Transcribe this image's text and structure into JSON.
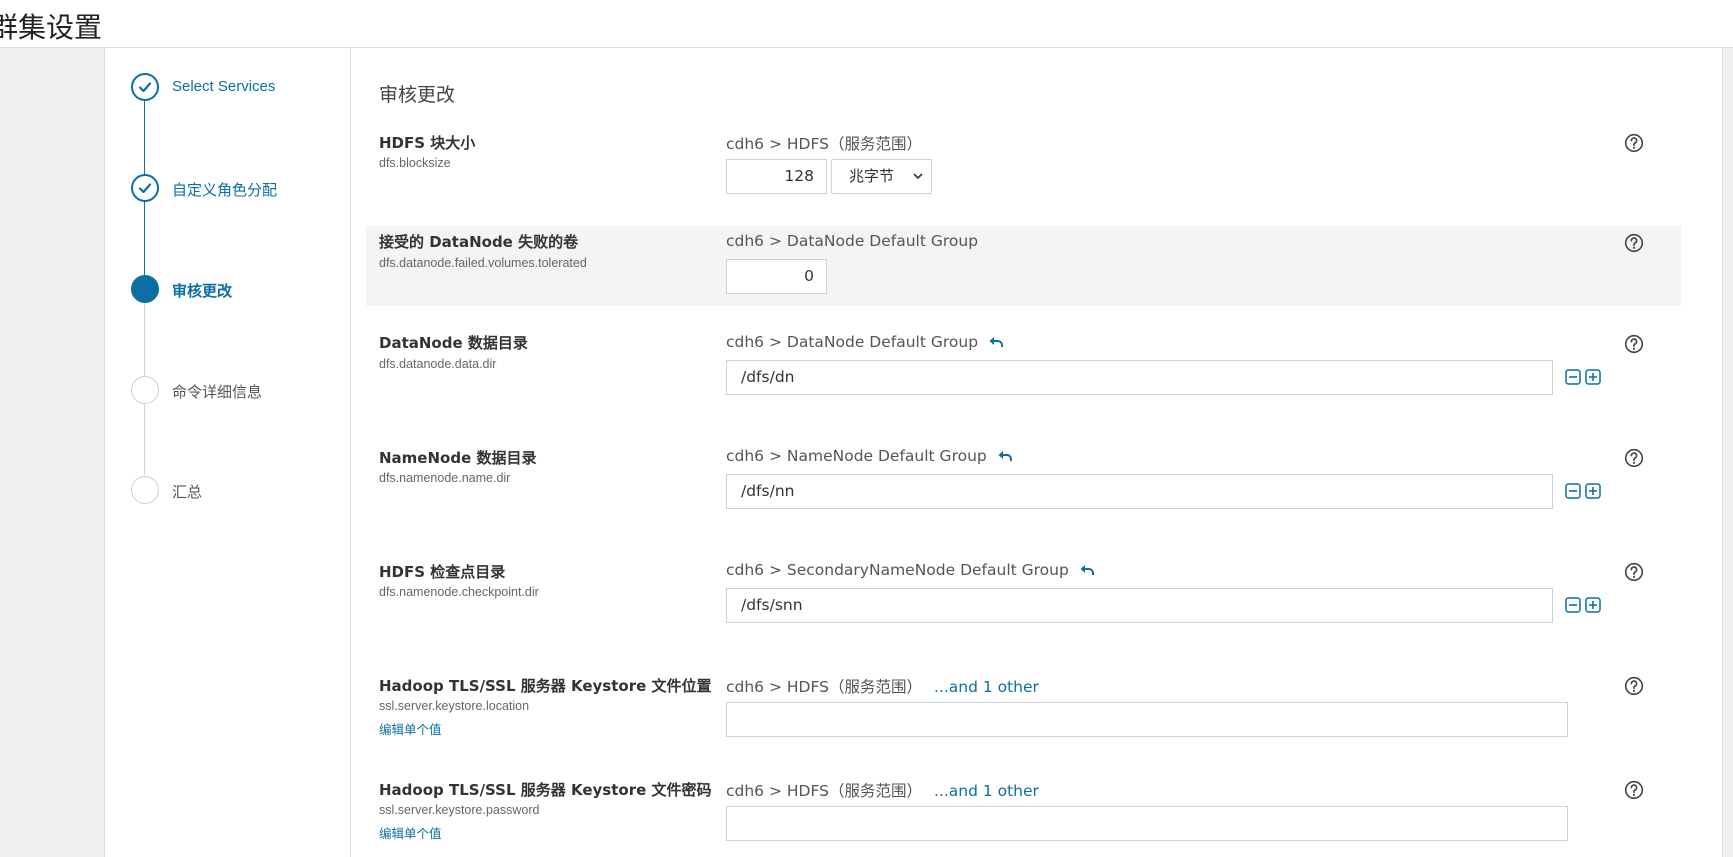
{
  "page": {
    "title": "群集设置"
  },
  "wizard": {
    "steps": [
      {
        "label": "Select Services",
        "state": "done"
      },
      {
        "label": "自定义角色分配",
        "state": "done"
      },
      {
        "label": "审核更改",
        "state": "active"
      },
      {
        "label": "命令详细信息",
        "state": "pending"
      },
      {
        "label": "汇总",
        "state": "pending"
      }
    ]
  },
  "main": {
    "section_title": "审核更改",
    "properties": [
      {
        "name": "HDFS 块大小",
        "key": "dfs.blocksize",
        "scope": "cdh6 > HDFS（服务范围）",
        "value": "128",
        "unit": "兆字节"
      },
      {
        "name": "接受的 DataNode 失败的卷",
        "key": "dfs.datanode.failed.volumes.tolerated",
        "scope": "cdh6 > DataNode Default Group",
        "value": "0"
      },
      {
        "name": "DataNode 数据目录",
        "key": "dfs.datanode.data.dir",
        "scope": "cdh6 > DataNode Default Group",
        "value": "/dfs/dn"
      },
      {
        "name": "NameNode 数据目录",
        "key": "dfs.namenode.name.dir",
        "scope": "cdh6 > NameNode Default Group",
        "value": "/dfs/nn"
      },
      {
        "name": "HDFS 检查点目录",
        "key": "dfs.namenode.checkpoint.dir",
        "scope": "cdh6 > SecondaryNameNode Default Group",
        "value": "/dfs/snn"
      },
      {
        "name": "Hadoop TLS/SSL 服务器 Keystore 文件位置",
        "key": "ssl.server.keystore.location",
        "edit_link": "编辑单个值",
        "scope": "cdh6 > HDFS（服务范围）",
        "scope_other": "...and 1 other",
        "value": ""
      },
      {
        "name": "Hadoop TLS/SSL 服务器 Keystore 文件密码",
        "key": "ssl.server.keystore.password",
        "edit_link": "编辑单个值",
        "scope": "cdh6 > HDFS（服务范围）",
        "scope_other": "...and 1 other",
        "value": ""
      }
    ]
  },
  "icons": {
    "check": "check-icon",
    "undo": "undo-icon",
    "remove": "minus-box-icon",
    "add": "plus-box-icon",
    "help": "help-circle-icon",
    "caret": "chevron-down-icon"
  },
  "colors": {
    "accent": "#0b6fa4",
    "highlight_row": "#f3f4f5",
    "gutter": "#eef0f2"
  }
}
